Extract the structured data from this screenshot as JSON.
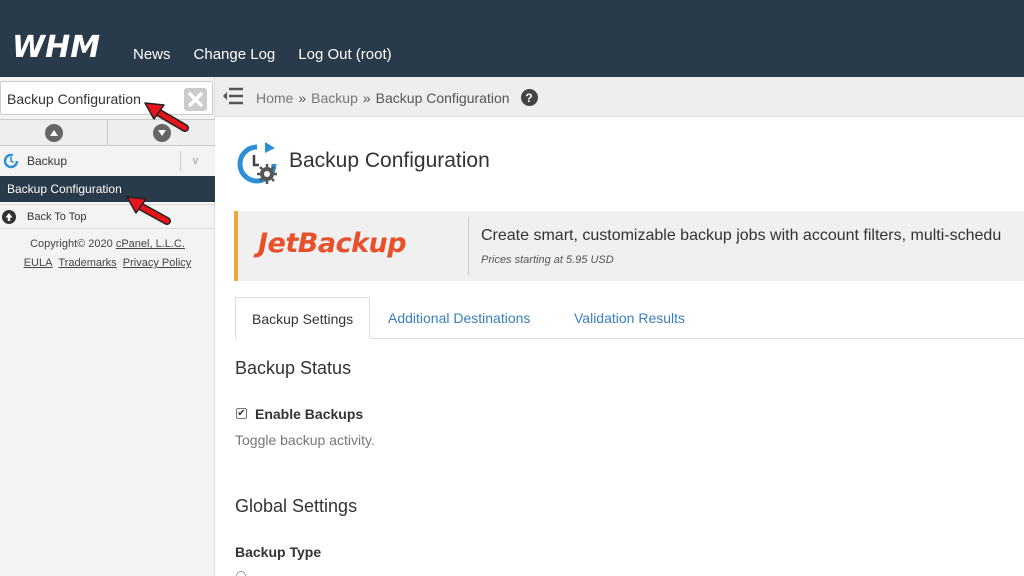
{
  "header": {
    "logo_text": "WHM",
    "nav": [
      {
        "label": "News"
      },
      {
        "label": "Change Log"
      },
      {
        "label": "Log Out (root)"
      }
    ]
  },
  "sidebar": {
    "search": {
      "value": "Backup Configuration"
    },
    "category": {
      "label": "Backup",
      "chevron": "v"
    },
    "active_item": {
      "label": "Backup Configuration"
    },
    "back_to_top": {
      "label": "Back To Top"
    },
    "footer": {
      "copyright_prefix": "Copyright© 2020 ",
      "company": "cPanel, L.L.C.",
      "links": [
        "EULA",
        "Trademarks",
        "Privacy Policy"
      ]
    }
  },
  "breadcrumb": {
    "items": [
      {
        "label": "Home"
      },
      {
        "label": "Backup"
      },
      {
        "label": "Backup Configuration"
      }
    ],
    "separator": "»",
    "help": "?"
  },
  "main": {
    "title": "Backup Configuration",
    "banner": {
      "logo_text": "JetBackup",
      "text": "Create smart, customizable backup jobs with account filters, multi-schedu",
      "subtext": "Prices starting at 5.95 USD",
      "accent_color": "#f0a43c",
      "logo_color": "#e8502b"
    },
    "tabs": [
      {
        "label": "Backup Settings",
        "active": true
      },
      {
        "label": "Additional Destinations",
        "active": false
      },
      {
        "label": "Validation Results",
        "active": false
      }
    ],
    "backup_status": {
      "heading": "Backup Status",
      "checkbox_label": "Enable Backups",
      "checked": true,
      "checkmark": "✔",
      "help": "Toggle backup activity."
    },
    "global_settings": {
      "heading": "Global Settings",
      "backup_type_label": "Backup Type"
    }
  },
  "colors": {
    "topbar": "#293a4a",
    "link": "#3b7ec0",
    "annotation_arrow": "#e8141b"
  }
}
